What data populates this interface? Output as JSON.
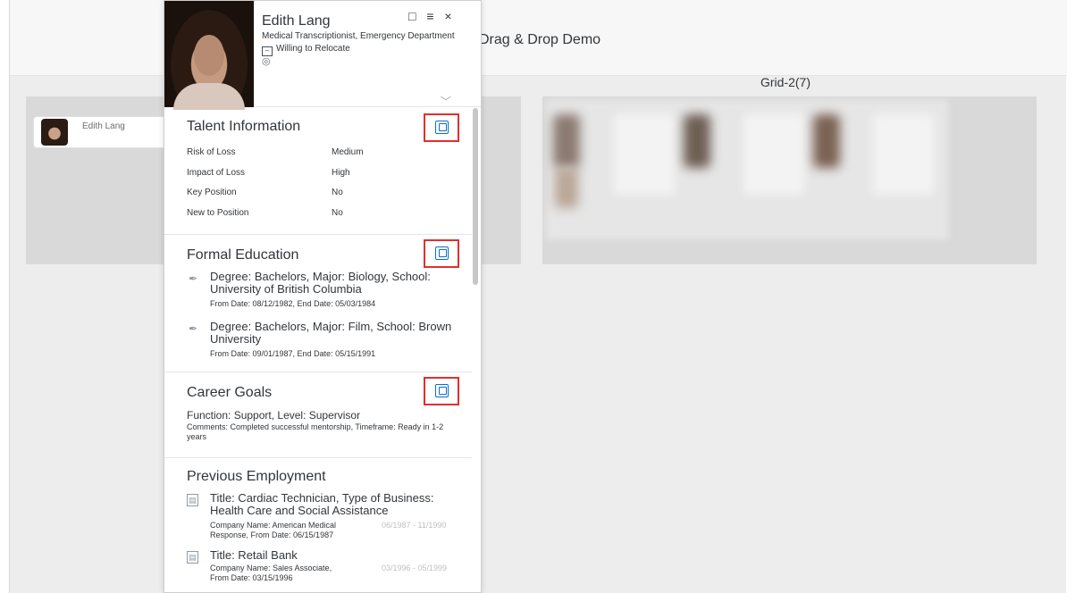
{
  "app": {
    "title": "Drag & Drop Demo",
    "grid2_title": "Grid-2(7)",
    "card_name": "Edith Lang"
  },
  "panel": {
    "name": "Edith Lang",
    "subtitle": "Medical Transcriptionist, Emergency Department",
    "relocate": "Willing to Relocate",
    "tools": {
      "sidebar_icon": "□",
      "menu_icon": "≡",
      "close_icon": "×"
    },
    "chevron": "⌵"
  },
  "talent": {
    "title": "Talent Information",
    "rows": [
      {
        "label": "Risk of Loss",
        "value": "Medium"
      },
      {
        "label": "Impact of Loss",
        "value": "High"
      },
      {
        "label": "Key Position",
        "value": "No"
      },
      {
        "label": "New to Position",
        "value": "No"
      }
    ]
  },
  "education": {
    "title": "Formal Education",
    "items": [
      {
        "main": "Degree: Bachelors, Major: Biology, School: University of British Columbia",
        "sub": "From Date: 08/12/1982, End Date: 05/03/1984"
      },
      {
        "main": "Degree: Bachelors, Major: Film, School: Brown University",
        "sub": "From Date: 09/01/1987, End Date: 05/15/1991"
      }
    ]
  },
  "career": {
    "title": "Career Goals",
    "main": "Function: Support, Level: Supervisor",
    "sub": "Comments: Completed successful mentorship, Timeframe: Ready in 1-2 years"
  },
  "employment": {
    "title": "Previous Employment",
    "items": [
      {
        "main": "Title: Cardiac Technician, Type of Business: Health Care and Social Assistance",
        "sub1": "Company Name: American Medical",
        "sub2": "Response, From Date: 06/15/1987",
        "dates": "06/1987 - 11/1990"
      },
      {
        "main": "Title: Retail Bank",
        "sub1": "Company Name: Sales Associate,",
        "sub2": "From Date: 03/15/1996",
        "dates": "03/1996 - 05/1999"
      }
    ]
  }
}
